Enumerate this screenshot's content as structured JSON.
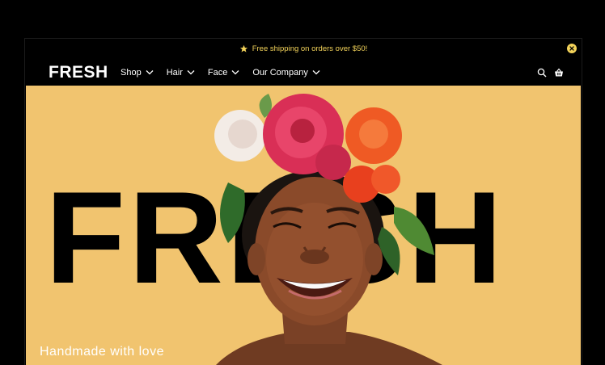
{
  "announcement": {
    "text": "Free shipping on orders over $50!",
    "icon": "star-icon",
    "close_icon": "close-icon",
    "color": "#f3d35a"
  },
  "header": {
    "logo": "FRESH",
    "menu": [
      {
        "label": "Shop",
        "icon": "chevron-down-icon"
      },
      {
        "label": "Hair",
        "icon": "chevron-down-icon"
      },
      {
        "label": "Face",
        "icon": "chevron-down-icon"
      },
      {
        "label": "Our Company",
        "icon": "chevron-down-icon"
      }
    ],
    "icons": [
      "search-icon",
      "basket-icon"
    ]
  },
  "hero": {
    "word": "FRESH",
    "tagline": "Handmade with love",
    "background": "#f1c46f"
  }
}
